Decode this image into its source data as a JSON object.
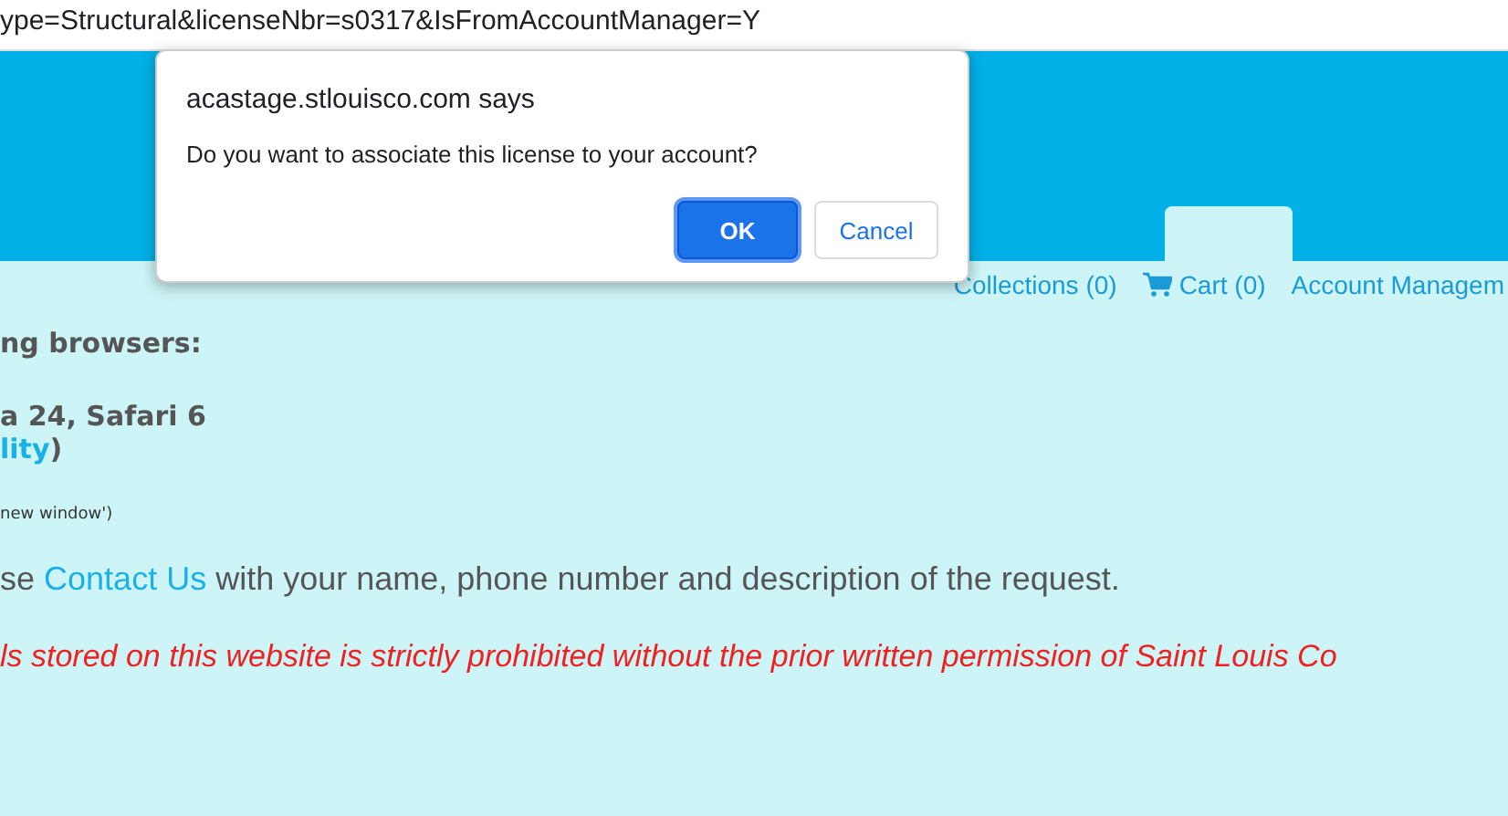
{
  "address_bar": {
    "url": "ype=Structural&licenseNbr=s0317&IsFromAccountManager=Y"
  },
  "nav": {
    "items": [
      {
        "kind": "link",
        "label": "Collections (0)"
      },
      {
        "kind": "cart",
        "label": "Cart (0)"
      },
      {
        "kind": "link",
        "label": "Account Managem"
      }
    ]
  },
  "content": {
    "browsers_heading": "ng browsers:",
    "browsers_line": "a 24, Safari 6",
    "compat_link": "lity",
    "compat_close": ")",
    "window_note": "new window')",
    "contact_before": "se",
    "contact_link": "Contact Us",
    "contact_after": "with your name, phone number and description of the request.",
    "warning": "ls stored on this website is strictly prohibited without the prior written permission of Saint Louis Co"
  },
  "dialog": {
    "title": "acastage.stlouisco.com says",
    "message": "Do you want to associate this license to your account?",
    "buttons": [
      {
        "label": "OK",
        "selected": true
      },
      {
        "label": "Cancel",
        "selected": false
      }
    ]
  }
}
